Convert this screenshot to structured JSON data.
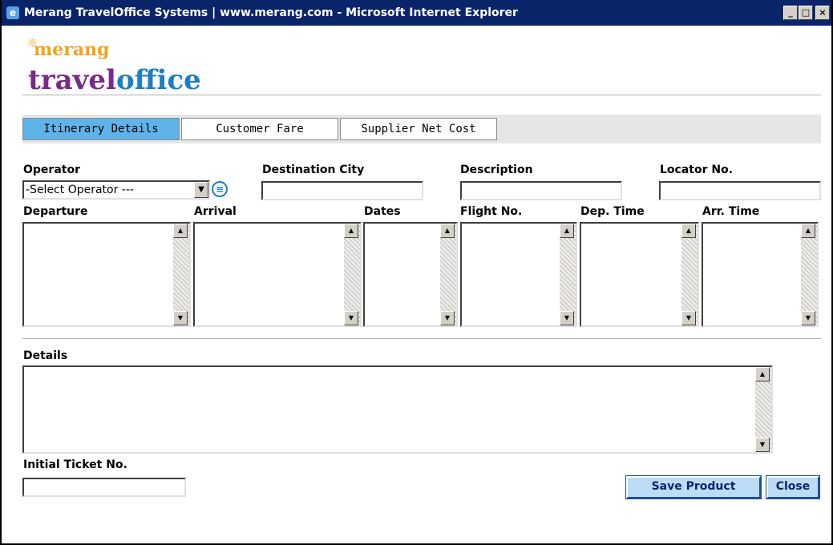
{
  "window": {
    "title": "Merang TravelOffice Systems | www.merang.com - Microsoft Internet Explorer"
  },
  "logo": {
    "top": "merang",
    "bottom_part1": "travel",
    "bottom_part2": "office"
  },
  "tabs": [
    {
      "label": "Itinerary Details",
      "active": true
    },
    {
      "label": "Customer Fare",
      "active": false
    },
    {
      "label": "Supplier Net Cost",
      "active": false
    }
  ],
  "form": {
    "operator_label": "Operator",
    "operator_selected": "-Select Operator ---",
    "destination_label": "Destination City",
    "destination_value": "",
    "description_label": "Description",
    "description_value": "",
    "locator_label": "Locator No.",
    "locator_value": "",
    "departure_label": "Departure",
    "arrival_label": "Arrival",
    "dates_label": "Dates",
    "flight_label": "Flight No.",
    "dep_time_label": "Dep. Time",
    "arr_time_label": "Arr. Time",
    "details_label": "Details",
    "initial_ticket_label": "Initial Ticket No.",
    "initial_ticket_value": ""
  },
  "buttons": {
    "save": "Save Product",
    "close": "Close"
  },
  "colors": {
    "titlebar": "#0a246a",
    "active_tab": "#5fb3e8",
    "button_bg": "#bcdcf6",
    "logo_orange": "#f2a31c",
    "logo_purple": "#7a2a8a",
    "logo_blue": "#1c7fc1"
  }
}
